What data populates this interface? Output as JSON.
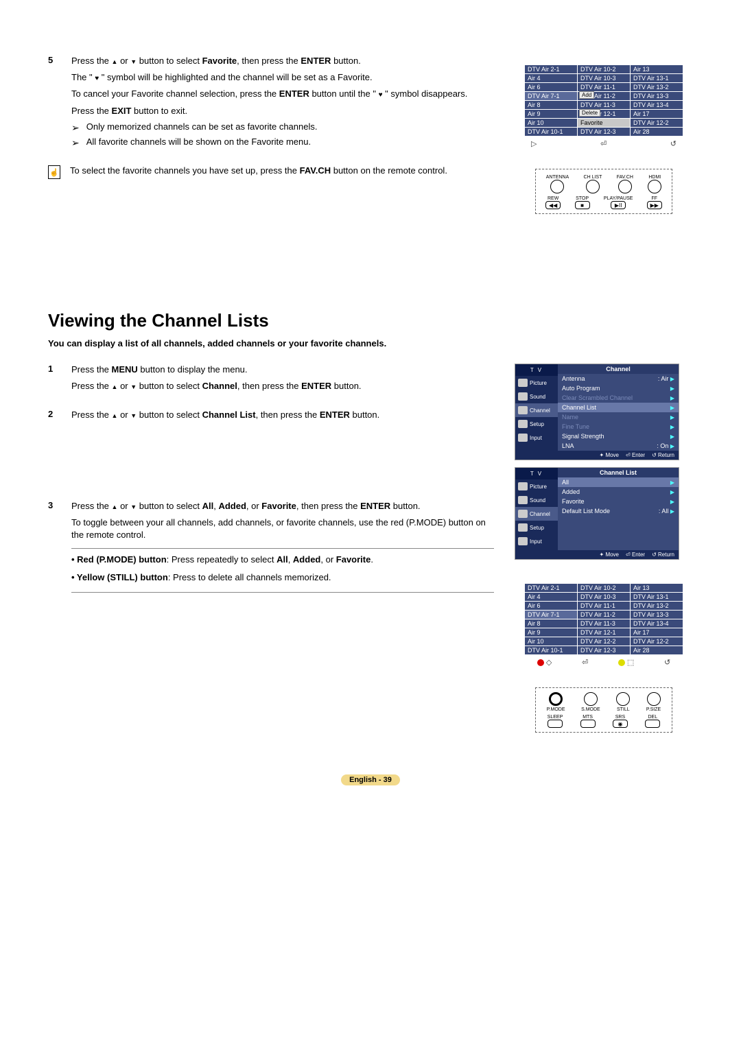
{
  "step5": {
    "num": "5",
    "p1a": "Press the ",
    "p1b": " or ",
    "p1c": " button to select ",
    "p1d": "Favorite",
    "p1e": ", then press the ",
    "p1f": "ENTER",
    "p1g": " button.",
    "p2a": "The \" ",
    "p2b": " \" symbol will be highlighted and the channel will be set as a Favorite.",
    "p3a": "To cancel your Favorite channel selection, press the ",
    "p3b": "ENTER",
    "p3c": " button until the \" ",
    "p3d": " \" symbol disappears.",
    "p4a": "Press the ",
    "p4b": "EXIT",
    "p4c": " button to exit.",
    "note1": "Only memorized channels can be set as favorite channels.",
    "note2": "All favorite channels will be shown on the Favorite menu."
  },
  "info1a": "To select the favorite channels you have set up, press the ",
  "info1b": "FAV.CH",
  "info1c": " button on the remote control.",
  "heading": "Viewing the Channel Lists",
  "subhead": "You can display a list of all channels, added channels or your favorite channels.",
  "step1": {
    "num": "1",
    "p1a": "Press the ",
    "p1b": "MENU",
    "p1c": " button to display the menu.",
    "p2a": "Press the ",
    "p2b": " or ",
    "p2c": " button to select ",
    "p2d": "Channel",
    "p2e": ", then press the ",
    "p2f": "ENTER",
    "p2g": " button."
  },
  "step2": {
    "num": "2",
    "p1a": "Press the ",
    "p1b": " or ",
    "p1c": " button to select ",
    "p1d": "Channel List",
    "p1e": ", then press the ",
    "p1f": "ENTER",
    "p1g": " button."
  },
  "step3": {
    "num": "3",
    "p1a": "Press the ",
    "p1b": " or ",
    "p1c": " button to select ",
    "p1d": "All",
    "p1e": ", ",
    "p1f": "Added",
    "p1g": ", or ",
    "p1h": "Favorite",
    "p1i": ", then press the ",
    "p1j": "ENTER",
    "p1k": " button.",
    "p2": "To toggle between your all channels, add channels, or favorite channels, use the red (P.MODE) button on the remote control.",
    "tip1a": "• Red (P.MODE) button",
    "tip1b": ": Press repeatedly to select ",
    "tip1c": "All",
    "tip1d": ", ",
    "tip1e": "Added",
    "tip1f": ", or ",
    "tip1g": "Favorite",
    "tip1h": ".",
    "tip2a": "• Yellow (STILL) button",
    "tip2b": ": Press to delete all channels memorized."
  },
  "grid1": {
    "rows": [
      [
        "DTV Air 2-1",
        "DTV Air 10-2",
        "Air 13"
      ],
      [
        "Air 4",
        "DTV Air 10-3",
        "DTV Air 13-1"
      ],
      [
        "Air 6",
        "DTV Air 11-1",
        "DTV Air 13-2"
      ],
      [
        "DTV Air 7-1",
        "DTV Air 11-2",
        "DTV Air 13-3"
      ],
      [
        "Air 8",
        "DTV Air 11-3",
        "DTV Air 13-4"
      ],
      [
        "Air 9",
        "DTV Air 12-1",
        "Air 17"
      ],
      [
        "Air 10",
        "Favorite",
        "DTV Air 12-2"
      ],
      [
        "DTV Air 10-1",
        "DTV Air 12-3",
        "Air 28"
      ]
    ],
    "overlay_add": "Add",
    "overlay_del": "Delete",
    "nav_left": "▷",
    "nav_mid": "⏎",
    "nav_right": "↺"
  },
  "remote1": {
    "row1": [
      "ANTENNA",
      "CH LIST",
      "FAV.CH",
      "HDMI"
    ],
    "row2": [
      "REW",
      "STOP",
      "PLAY/PAUSE",
      "FF"
    ],
    "glyphs": [
      "◀◀",
      "■",
      "▶II",
      "▶▶"
    ]
  },
  "menu1": {
    "tv": "T V",
    "side": [
      "Picture",
      "Sound",
      "Channel",
      "Setup",
      "Input"
    ],
    "title": "Channel",
    "lines": [
      {
        "label": "Antenna",
        "val": ": Air",
        "dim": false
      },
      {
        "label": "Auto Program",
        "val": "",
        "dim": false
      },
      {
        "label": "Clear Scrambled Channel",
        "val": "",
        "dim": true
      },
      {
        "label": "Channel List",
        "val": "",
        "dim": false,
        "hi": true
      },
      {
        "label": "Name",
        "val": "",
        "dim": true
      },
      {
        "label": "Fine Tune",
        "val": "",
        "dim": true
      },
      {
        "label": "Signal Strength",
        "val": "",
        "dim": false
      },
      {
        "label": "LNA",
        "val": ": On",
        "dim": false
      }
    ],
    "nav": [
      "✦ Move",
      "⏎ Enter",
      "↺ Return"
    ]
  },
  "menu2": {
    "tv": "T V",
    "side": [
      "Picture",
      "Sound",
      "Channel",
      "Setup",
      "Input"
    ],
    "title": "Channel List",
    "lines": [
      {
        "label": "All",
        "val": "",
        "hi": true
      },
      {
        "label": "Added",
        "val": ""
      },
      {
        "label": "Favorite",
        "val": ""
      },
      {
        "label": "Default List Mode",
        "val": ": All"
      }
    ],
    "nav": [
      "✦ Move",
      "⏎ Enter",
      "↺ Return"
    ]
  },
  "grid2": {
    "rows": [
      [
        "DTV Air 2-1",
        "DTV Air 10-2",
        "Air 13"
      ],
      [
        "Air 4",
        "DTV Air 10-3",
        "DTV Air 13-1"
      ],
      [
        "Air 6",
        "DTV Air 11-1",
        "DTV Air 13-2"
      ],
      [
        "DTV Air 7-1",
        "DTV Air 11-2",
        "DTV Air 13-3"
      ],
      [
        "Air 8",
        "DTV Air 11-3",
        "DTV Air 13-4"
      ],
      [
        "Air 9",
        "DTV Air 12-1",
        "Air 17"
      ],
      [
        "Air 10",
        "DTV Air 12-2",
        "DTV Air 12-2"
      ],
      [
        "DTV Air 10-1",
        "DTV Air 12-3",
        "Air 28"
      ]
    ],
    "nav": [
      "◇",
      "⏎",
      "⬚",
      "↺"
    ]
  },
  "remote2": {
    "row1": [
      "P.MODE",
      "S.MODE",
      "STILL",
      "P.SIZE"
    ],
    "row2": [
      "SLEEP",
      "MTS",
      "SRS",
      "DEL"
    ]
  },
  "footer": "English - 39"
}
